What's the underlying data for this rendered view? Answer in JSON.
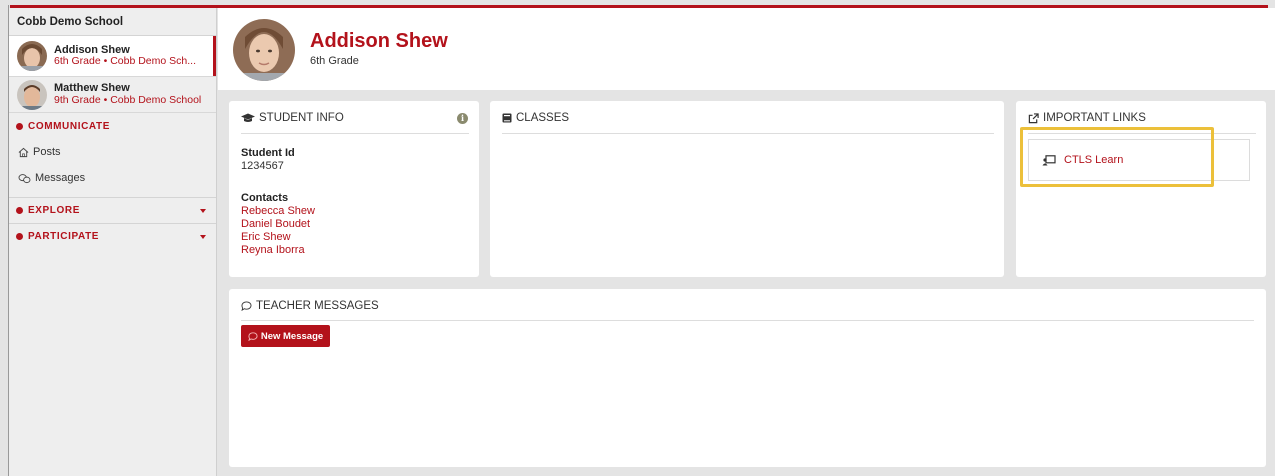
{
  "sidebar": {
    "school": "Cobb Demo School",
    "students": [
      {
        "name": "Addison Shew",
        "sub": "6th Grade • Cobb Demo Sch..."
      },
      {
        "name": "Matthew Shew",
        "sub": "9th Grade • Cobb Demo School"
      }
    ],
    "communicate": "COMMUNICATE",
    "posts": "Posts",
    "messages": "Messages",
    "explore": "EXPLORE",
    "participate": "PARTICIPATE"
  },
  "header": {
    "name": "Addison Shew",
    "grade": "6th Grade"
  },
  "student_info": {
    "title": "STUDENT INFO",
    "info_icon": "i",
    "student_id_label": "Student Id",
    "student_id": "1234567",
    "contacts_label": "Contacts",
    "contacts": [
      "Rebecca Shew",
      "Daniel Boudet",
      "Eric Shew",
      "Reyna Iborra"
    ]
  },
  "classes": {
    "title": "CLASSES"
  },
  "links": {
    "title": "IMPORTANT LINKS",
    "items": [
      {
        "label": "CTLS Learn",
        "icon": "learn-icon"
      }
    ]
  },
  "teacher_messages": {
    "title": "TEACHER MESSAGES",
    "new_button": "New Message"
  },
  "colors": {
    "accent": "#b3121b",
    "highlight": "#ecc03a",
    "background": "#e4e4e4"
  }
}
